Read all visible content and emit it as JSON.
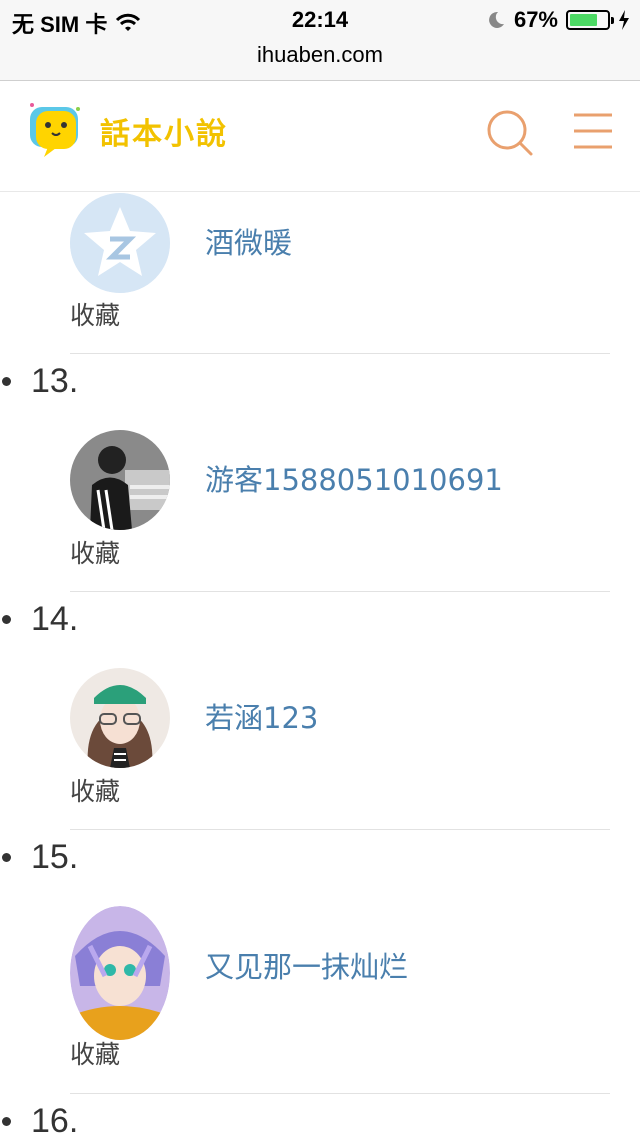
{
  "status_bar": {
    "carrier": "无 SIM 卡",
    "time": "22:14",
    "battery_percent": "67%",
    "battery_level": 0.67
  },
  "browser": {
    "url": "ihuaben.com"
  },
  "header": {
    "logo_text": "話本小說",
    "search_icon": "search-icon",
    "menu_icon": "menu-icon",
    "accent_color": "#e9a06e"
  },
  "list": {
    "entries": [
      {
        "rank": "",
        "name": "酒微暖",
        "fav_label": "收藏"
      },
      {
        "rank": "13.",
        "name": "游客1588051010691",
        "fav_label": "收藏"
      },
      {
        "rank": "14.",
        "name": "若涵123",
        "fav_label": "收藏"
      },
      {
        "rank": "15.",
        "name": "又见那一抹灿烂",
        "fav_label": "收藏"
      },
      {
        "rank": "16.",
        "name": "",
        "fav_label": ""
      }
    ]
  }
}
